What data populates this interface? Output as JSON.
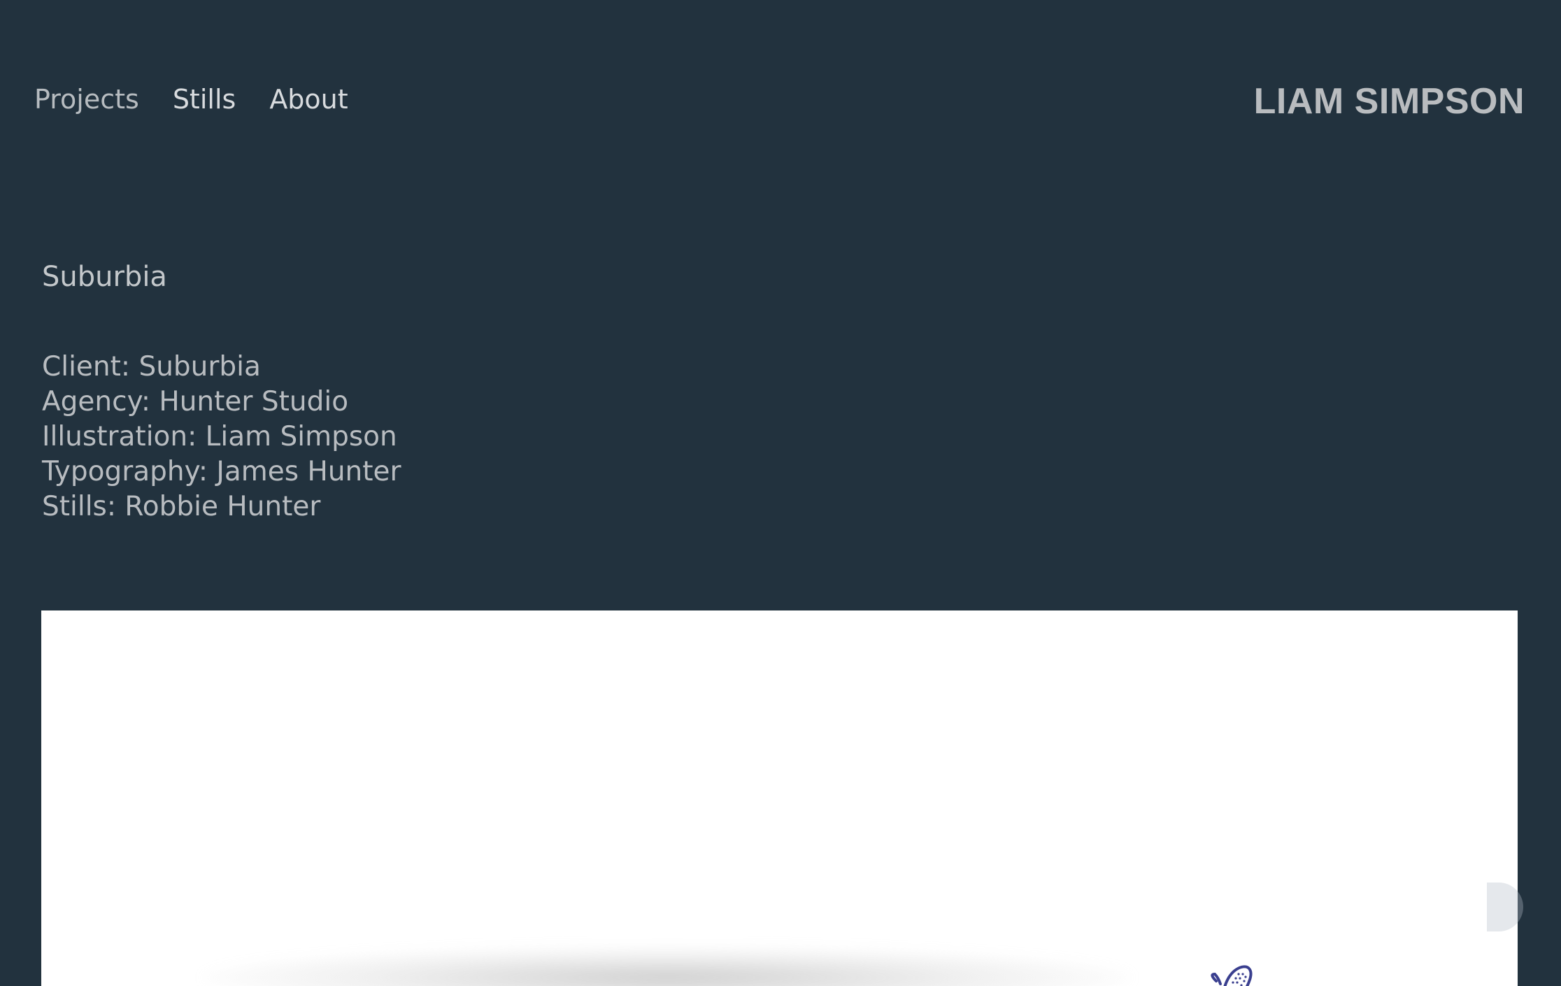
{
  "nav": {
    "items": [
      {
        "label": "Projects"
      },
      {
        "label": "Stills"
      },
      {
        "label": "About"
      }
    ]
  },
  "brand": {
    "name": "LIAM SIMPSON"
  },
  "project": {
    "title": "Suburbia",
    "credits": [
      "Client: Suburbia",
      "Agency: Hunter Studio",
      "Illustration: Liam Simpson",
      "Typography: James Hunter",
      "Stills: Robbie Hunter"
    ]
  },
  "colors": {
    "background": "#22323e",
    "panel": "#ffffff",
    "illustration_ink": "#3a3f8f"
  }
}
